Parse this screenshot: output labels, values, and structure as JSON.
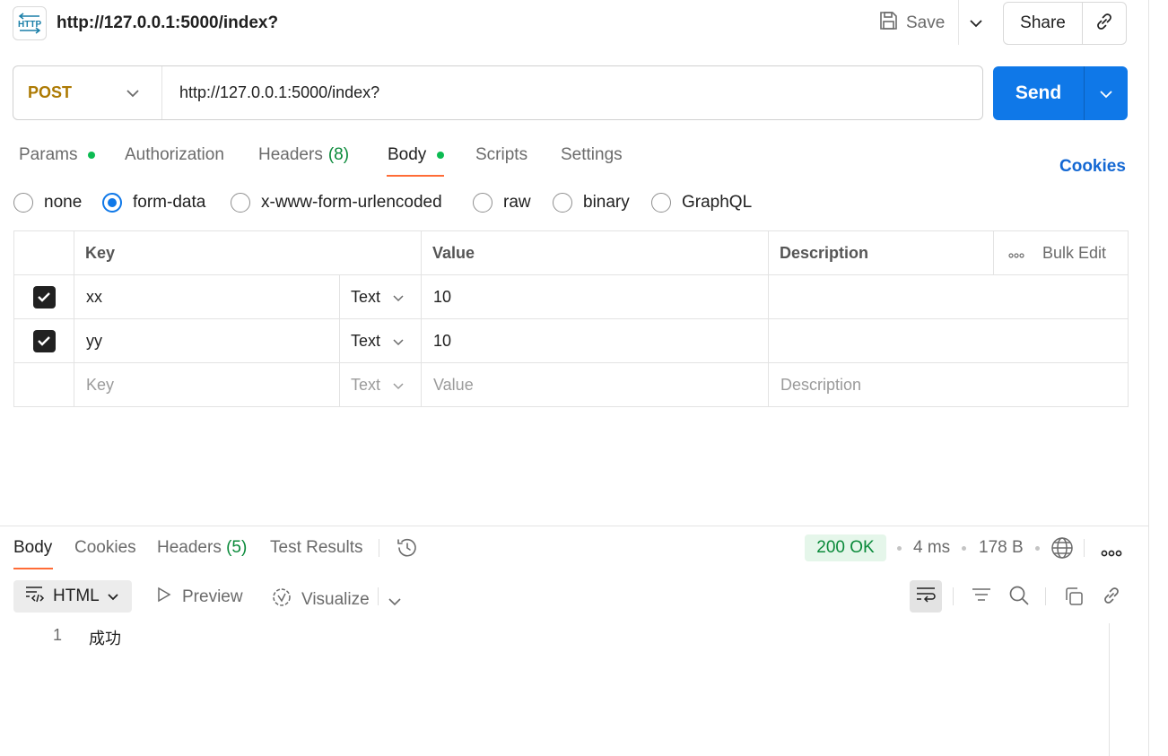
{
  "request": {
    "title": "http://127.0.0.1:5000/index?",
    "method": "POST",
    "url": "http://127.0.0.1:5000/index?",
    "method_color": "#ad7a03"
  },
  "toolbar": {
    "save_label": "Save",
    "share_label": "Share",
    "send_label": "Send"
  },
  "tabs": {
    "params": "Params",
    "authorization": "Authorization",
    "headers": "Headers",
    "headers_count": "(8)",
    "body": "Body",
    "scripts": "Scripts",
    "settings": "Settings",
    "active": "Body"
  },
  "cookies_label": "Cookies",
  "body_modes": {
    "options": [
      "none",
      "form-data",
      "x-www-form-urlencoded",
      "raw",
      "binary",
      "GraphQL"
    ],
    "selected": "form-data"
  },
  "table": {
    "headers": {
      "key": "Key",
      "value": "Value",
      "description": "Description",
      "bulk_edit": "Bulk Edit"
    },
    "rows": [
      {
        "checked": true,
        "key": "xx",
        "type": "Text",
        "value": "10",
        "description": ""
      },
      {
        "checked": true,
        "key": "yy",
        "type": "Text",
        "value": "10",
        "description": ""
      }
    ],
    "placeholder": {
      "key": "Key",
      "type": "Text",
      "value": "Value",
      "description": "Description"
    }
  },
  "response": {
    "tabs": {
      "body": "Body",
      "cookies": "Cookies",
      "headers": "Headers",
      "headers_count": "(5)",
      "test_results": "Test Results",
      "active": "Body"
    },
    "status": "200 OK",
    "time": "4 ms",
    "size": "178 B",
    "format": "HTML",
    "preview_label": "Preview",
    "visualize_label": "Visualize",
    "lines": [
      {
        "number": "1",
        "text": "成功"
      }
    ]
  },
  "colors": {
    "accent": "#0f78e8",
    "tab_underline": "#ff6c37",
    "status_ok_bg": "#e5f6ea",
    "status_ok_text": "#0a8a3a"
  },
  "icons": [
    "http-icon",
    "save-icon",
    "chevron-down-icon",
    "link-icon",
    "history-icon",
    "globe-icon",
    "more-icon",
    "code-icon",
    "play-icon",
    "visualize-icon",
    "wrap-icon",
    "filter-icon",
    "search-icon",
    "copy-icon"
  ]
}
